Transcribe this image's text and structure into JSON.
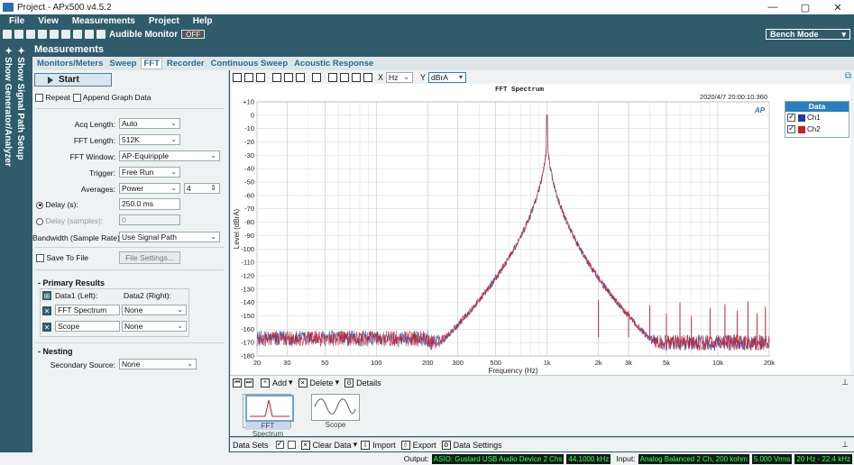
{
  "window": {
    "title": "Project - APx500 v4.5.2"
  },
  "menu": [
    "File",
    "View",
    "Measurements",
    "Project",
    "Help"
  ],
  "toolbar": {
    "audible_monitor": "Audible Monitor",
    "off_label": "OFF",
    "bench_mode": "Bench Mode"
  },
  "side": {
    "generator": "Show Generator/Analyzer",
    "signal_path": "Show Signal Path Setup"
  },
  "measurements": {
    "header": "Measurements",
    "tabs": [
      "Monitors/Meters",
      "Sweep",
      "FFT",
      "Recorder",
      "Continuous Sweep",
      "Acoustic Response"
    ],
    "active_tab": "FFT"
  },
  "panel": {
    "start": "Start",
    "repeat": "Repeat",
    "append": "Append Graph Data",
    "acq_length_label": "Acq Length:",
    "acq_length": "Auto",
    "fft_length_label": "FFT Length:",
    "fft_length": "512K",
    "fft_window_label": "FFT Window:",
    "fft_window": "AP-Equiripple",
    "trigger_label": "Trigger:",
    "trigger": "Free Run",
    "averages_label": "Averages:",
    "averages": "Power",
    "averages_count": "4",
    "delay_s_label": "Delay (s):",
    "delay_s": "250.0 ms",
    "delay_samples_label": "Delay (samples):",
    "delay_samples": "0",
    "bandwidth_label": "Bandwidth (Sample Rate):",
    "bandwidth": "Use Signal Path",
    "save_to_file": "Save To File",
    "file_settings": "File Settings...",
    "primary_results": "Primary Results",
    "data1": "Data1 (Left):",
    "data2": "Data2 (Right):",
    "row1_data1": "FFT Spectrum",
    "row1_data2": "None",
    "row2_data1": "Scope",
    "row2_data2": "None",
    "nesting": "Nesting",
    "secondary_source_label": "Secondary Source:",
    "secondary_source": "None"
  },
  "graph_toolbar": {
    "x_label": "X",
    "x_unit": "Hz",
    "y_label": "Y",
    "y_unit": "dBrA"
  },
  "chart_data": {
    "type": "line",
    "title": "FFT Spectrum",
    "timestamp": "2020/4/7 20:00:10.360",
    "logo": "AP",
    "xlabel": "Frequency (Hz)",
    "ylabel": "Level (dBrA)",
    "x_scale": "log",
    "xlim": [
      20,
      20000
    ],
    "ylim": [
      -180,
      10
    ],
    "x_ticks": [
      "20",
      "30",
      "50",
      "100",
      "200",
      "300",
      "500",
      "1k",
      "2k",
      "3k",
      "5k",
      "10k",
      "20k"
    ],
    "x_tick_values": [
      20,
      30,
      50,
      100,
      200,
      300,
      500,
      1000,
      2000,
      3000,
      5000,
      10000,
      20000
    ],
    "y_ticks": [
      "+10",
      "0",
      "-10",
      "-20",
      "-30",
      "-40",
      "-50",
      "-60",
      "-70",
      "-80",
      "-90",
      "-100",
      "-110",
      "-120",
      "-130",
      "-140",
      "-150",
      "-160",
      "-170",
      "-180"
    ],
    "y_tick_values": [
      10,
      0,
      -10,
      -20,
      -30,
      -40,
      -50,
      -60,
      -70,
      -80,
      -90,
      -100,
      -110,
      -120,
      -130,
      -140,
      -150,
      -160,
      -170,
      -180
    ],
    "grid": true,
    "legend_title": "Data",
    "series": [
      {
        "name": "Ch1",
        "color": "#1f3c9e",
        "fundamental_hz": 1000,
        "fundamental_db": 0,
        "noise_floor_db": -170
      },
      {
        "name": "Ch2",
        "color": "#c8202a",
        "fundamental_hz": 1000,
        "fundamental_db": 0,
        "noise_floor_db": -170
      }
    ],
    "spurs": [
      {
        "hz": 2000,
        "db": -138
      },
      {
        "hz": 3000,
        "db": -146
      },
      {
        "hz": 4000,
        "db": -142
      },
      {
        "hz": 5000,
        "db": -148
      },
      {
        "hz": 6000,
        "db": -140
      },
      {
        "hz": 7000,
        "db": -150
      },
      {
        "hz": 9000,
        "db": -144
      },
      {
        "hz": 11000,
        "db": -141
      },
      {
        "hz": 13000,
        "db": -146
      },
      {
        "hz": 15000,
        "db": -139
      },
      {
        "hz": 17000,
        "db": -148
      },
      {
        "hz": 19000,
        "db": -143
      }
    ]
  },
  "nav": {
    "add": "Add",
    "delete": "Delete",
    "details": "Details"
  },
  "thumbs": [
    {
      "label": "FFT Spectrum",
      "selected": true
    },
    {
      "label": "Scope",
      "selected": false
    }
  ],
  "datasets": {
    "label": "Data Sets",
    "clear": "Clear Data",
    "import": "Import",
    "export": "Export",
    "settings": "Data Settings"
  },
  "status": {
    "output_label": "Output:",
    "output_device": "ASIO: Gustard USB Audio Device 2 Chs",
    "output_rate": "44.1000 kHz",
    "input_label": "Input:",
    "input_device": "Analog Balanced 2 Ch, 200 kohm",
    "input_level": "5.000 Vrms",
    "input_band": "20 Hz - 22.4 kHz"
  },
  "colors": {
    "accent": "#2f5b6b",
    "ch1": "#1f3c9e",
    "ch2": "#c8202a",
    "status_green": "#3dff57"
  }
}
